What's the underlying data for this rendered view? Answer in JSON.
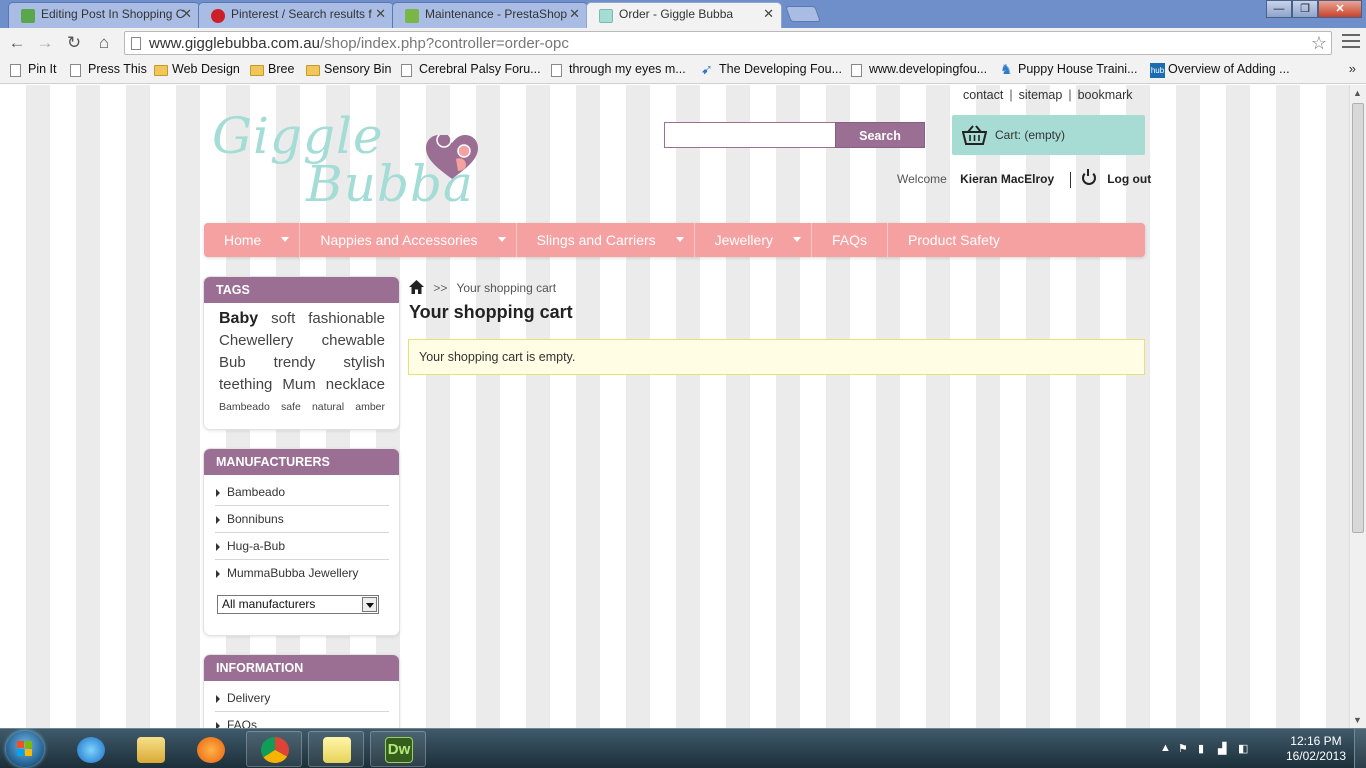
{
  "browser": {
    "tabs": [
      {
        "title": "Editing Post In Shopping C",
        "icon_color": "#5aa64b"
      },
      {
        "title": "Pinterest / Search results f",
        "icon_color": "#cb2027"
      },
      {
        "title": "Maintenance - PrestaShop",
        "icon_color": "#7ab648"
      },
      {
        "title": "Order - Giggle Bubba",
        "icon_color": "#a7dcd5"
      }
    ],
    "url_host": "www.gigglebubba.com.au",
    "url_path": "/shop/index.php?controller=order-opc",
    "window_buttons": {
      "minimize": "—",
      "maximize": "❐",
      "close": "✕"
    }
  },
  "bookmarks": [
    {
      "label": "Pin It",
      "icon": "page-icon"
    },
    {
      "label": "Press This",
      "icon": "page-icon"
    },
    {
      "label": "Web Design",
      "icon": "folder-icon"
    },
    {
      "label": "Bree",
      "icon": "folder-icon"
    },
    {
      "label": "Sensory Bin",
      "icon": "folder-icon"
    },
    {
      "label": "Cerebral Palsy Foru...",
      "icon": "page-icon"
    },
    {
      "label": "through my eyes m...",
      "icon": "page-icon"
    },
    {
      "label": "The Developing Fou...",
      "icon": "bird-icon"
    },
    {
      "label": "www.developingfou...",
      "icon": "page-icon"
    },
    {
      "label": "Puppy House Traini...",
      "icon": "dog-icon"
    },
    {
      "label": "Overview of Adding ...",
      "icon": "hub-icon"
    }
  ],
  "bookmark_hub_text": "hub",
  "bookmark_more": "»",
  "site": {
    "toplinks": [
      "contact",
      "sitemap",
      "bookmark"
    ],
    "logo_line1": "Giggle",
    "logo_line2": "Bubba",
    "search": {
      "placeholder": "",
      "button": "Search"
    },
    "cart_label": "Cart: (empty)",
    "welcome_label": "Welcome",
    "user_name": "Kieran MacElroy",
    "logout_label": "Log out",
    "menu": [
      {
        "label": "Home",
        "has_dropdown": true
      },
      {
        "label": "Nappies and Accessories",
        "has_dropdown": true
      },
      {
        "label": "Slings and Carriers",
        "has_dropdown": true
      },
      {
        "label": "Jewellery",
        "has_dropdown": true
      },
      {
        "label": "FAQs",
        "has_dropdown": false
      },
      {
        "label": "Product Safety",
        "has_dropdown": false
      }
    ],
    "colors": {
      "menu": "#f5a0a1",
      "block_header": "#9b6f93",
      "cart": "#a7dcd5",
      "logo": "#a4dcd6"
    }
  },
  "sidebar": {
    "tags": {
      "title": "TAGS",
      "rows": [
        [
          "Baby",
          "soft",
          "fashionable"
        ],
        [
          "Chewellery",
          "chewable"
        ],
        [
          "Bub",
          "trendy",
          "stylish"
        ],
        [
          "teething",
          "Mum",
          "necklace"
        ],
        [
          "Bambeado",
          "safe",
          "natural",
          "amber"
        ]
      ]
    },
    "manufacturers": {
      "title": "MANUFACTURERS",
      "items": [
        "Bambeado",
        "Bonnibuns",
        "Hug-a-Bub",
        "MummaBubba Jewellery"
      ],
      "select_value": "All manufacturers"
    },
    "information": {
      "title": "INFORMATION",
      "items": [
        "Delivery",
        "FAQs"
      ]
    }
  },
  "main": {
    "breadcrumb_sep": ">>",
    "breadcrumb_current": "Your shopping cart",
    "title": "Your shopping cart",
    "message": "Your shopping cart is empty."
  },
  "taskbar": {
    "apps": [
      "internet-explorer",
      "windows-explorer",
      "media-player",
      "chrome",
      "sticky-notes",
      "dreamweaver"
    ],
    "dreamweaver_label": "Dw",
    "time": "12:16 PM",
    "date": "16/02/2013"
  }
}
